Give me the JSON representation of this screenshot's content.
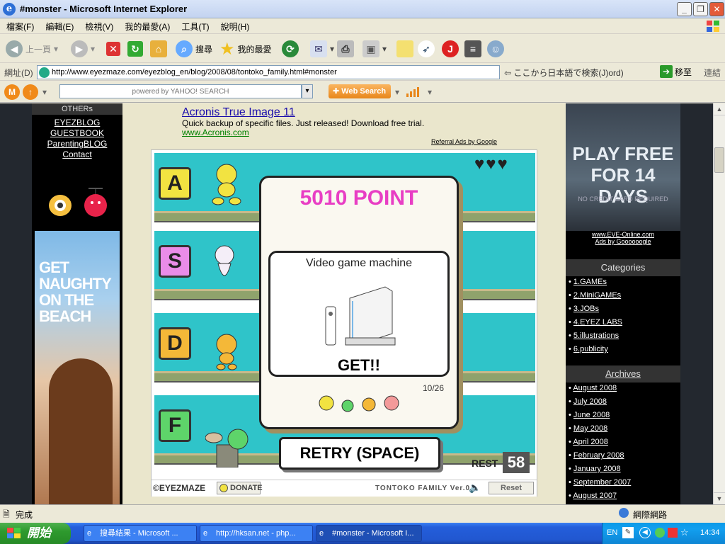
{
  "window": {
    "title": "#monster - Microsoft Internet Explorer"
  },
  "menu": [
    "檔案(F)",
    "編輯(E)",
    "檢視(V)",
    "我的最愛(A)",
    "工具(T)",
    "說明(H)"
  ],
  "toolbar": {
    "back": "上一頁",
    "search": "搜尋",
    "favorites": "我的最愛"
  },
  "address": {
    "label": "網址(D)",
    "url": "http://www.eyezmaze.com/eyezblog_en/blog/2008/08/tontoko_family.html#monster",
    "jp_search": "ここから日本語で検索(J)ord)",
    "go": "移至",
    "links": "連結"
  },
  "yahoo": {
    "placeholder": "powered by YAHOO! SEARCH",
    "web_search": "Web Search"
  },
  "left": {
    "heading": "OTHERs",
    "links": [
      "EYEZBLOG",
      "GUESTBOOK",
      "ParentingBLOG",
      "Contact"
    ],
    "ad_text": "GET NAUGHTY ON THE BEACH"
  },
  "ad": {
    "title": "Acronis True Image 11",
    "desc": "Quick backup of specific files. Just released! Download free trial.",
    "url": "www.Acronis.com",
    "referral": "Referral Ads by Google"
  },
  "game": {
    "lanes": [
      {
        "key": "A",
        "color": "#f2e341"
      },
      {
        "key": "S",
        "color": "#ea8ce8"
      },
      {
        "key": "D",
        "color": "#f4b838"
      },
      {
        "key": "F",
        "color": "#5ed46a"
      }
    ],
    "lives": 3,
    "score": "5010 POINT",
    "prize_name": "Video game machine",
    "get": "GET!!",
    "progress": "10/26",
    "retry": "RETRY (SPACE)",
    "rest_label": "REST",
    "rest_value": "58",
    "footer": {
      "brand": "©EYEZMAZE",
      "donate": "DONATE",
      "version": "TONTOKO FAMILY Ver.0",
      "reset": "Reset"
    }
  },
  "right": {
    "ad_line1": "PLAY FREE",
    "ad_line2": "FOR 14 DAYS",
    "ad_line3": "NO CREDIT CARD REQUIRED",
    "ad_link": "www.EVE-Online.com",
    "ads_by": "Ads by Goooooogle",
    "categories_title": "Categories",
    "categories": [
      "1.GAMEs",
      "2.MiniGAMEs",
      "3.JOBs",
      "4.EYEZ LABS",
      "5.illustrations",
      "6.publicity"
    ],
    "archives_title": "Archives",
    "archives": [
      "August 2008",
      "July 2008",
      "June 2008",
      "May 2008",
      "April 2008",
      "February 2008",
      "January 2008",
      "September 2007",
      "August 2007"
    ]
  },
  "status": {
    "left": "完成",
    "right": "網際網路"
  },
  "taskbar": {
    "start": "開始",
    "tasks": [
      "搜尋結果 - Microsoft ...",
      "http://hksan.net - php...",
      "#monster - Microsoft I..."
    ],
    "lang": "EN",
    "time": "14:34"
  }
}
